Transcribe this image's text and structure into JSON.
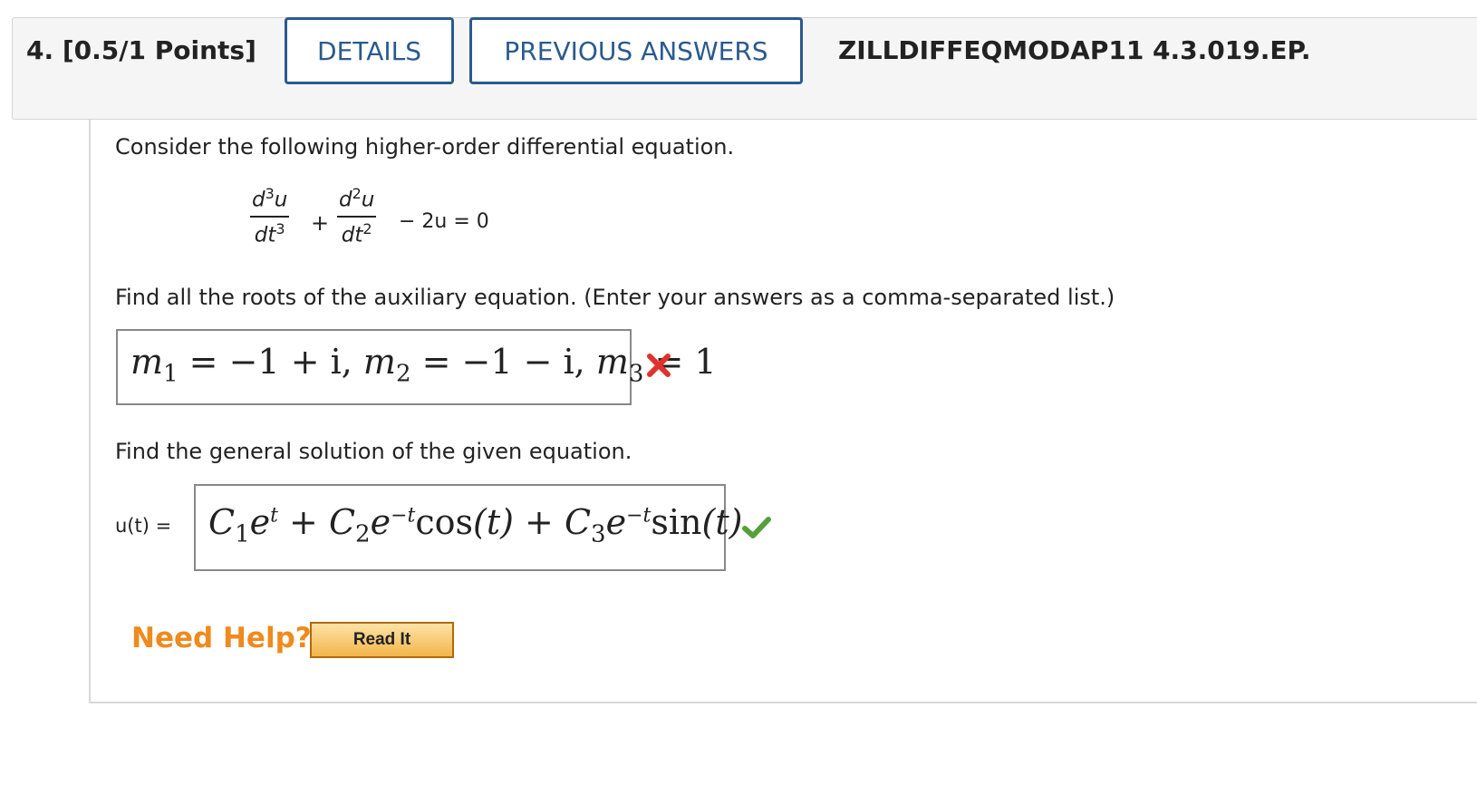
{
  "question": {
    "number_points": "4. [0.5/1 Points]",
    "details_label": "DETAILS",
    "previous_answers_label": "PREVIOUS ANSWERS",
    "code": "ZILLDIFFEQMODAP11 4.3.019.EP."
  },
  "body": {
    "intro": "Consider the following higher-order differential equation.",
    "equation": {
      "term1_num": "d",
      "term1_num_exp": "3",
      "term1_num_var": "u",
      "term1_den": "dt",
      "term1_den_exp": "3",
      "plus": "+",
      "term2_num": "d",
      "term2_num_exp": "2",
      "term2_num_var": "u",
      "term2_den": "dt",
      "term2_den_exp": "2",
      "rest": "− 2u = 0"
    },
    "part1_prompt": "Find all the roots of the auxiliary equation. (Enter your answers as a comma-separated list.)",
    "part1_answer": {
      "m1": "m",
      "m1_sub": "1",
      "m1_val": " = −1 + i, ",
      "m2": "m",
      "m2_sub": "2",
      "m2_val": " = −1 − i, ",
      "m3": "m",
      "m3_sub": "3",
      "m3_val": " = 1"
    },
    "part1_status_icon": "incorrect-x-icon",
    "part2_prompt": "Find the general solution of the given equation.",
    "part2_label": "u(t) =",
    "part2_answer": {
      "c1": "C",
      "c1_sub": "1",
      "e1": "e",
      "e1_exp": "t",
      "plus1": " + ",
      "c2": "C",
      "c2_sub": "2",
      "e2": "e",
      "e2_exp": "−t",
      "cos": "cos",
      "arg1": "(t)",
      "plus2": " + ",
      "c3": "C",
      "c3_sub": "3",
      "e3": "e",
      "e3_exp": "−t",
      "sin": "sin",
      "arg2": "(t)"
    },
    "part2_status_icon": "correct-check-icon"
  },
  "help": {
    "need_help": "Need Help?",
    "read_it": "Read It"
  },
  "colors": {
    "accent_blue": "#2a5a8e",
    "help_orange": "#ef8a1e",
    "incorrect_red": "#e0322b",
    "correct_green": "#55a03a"
  }
}
